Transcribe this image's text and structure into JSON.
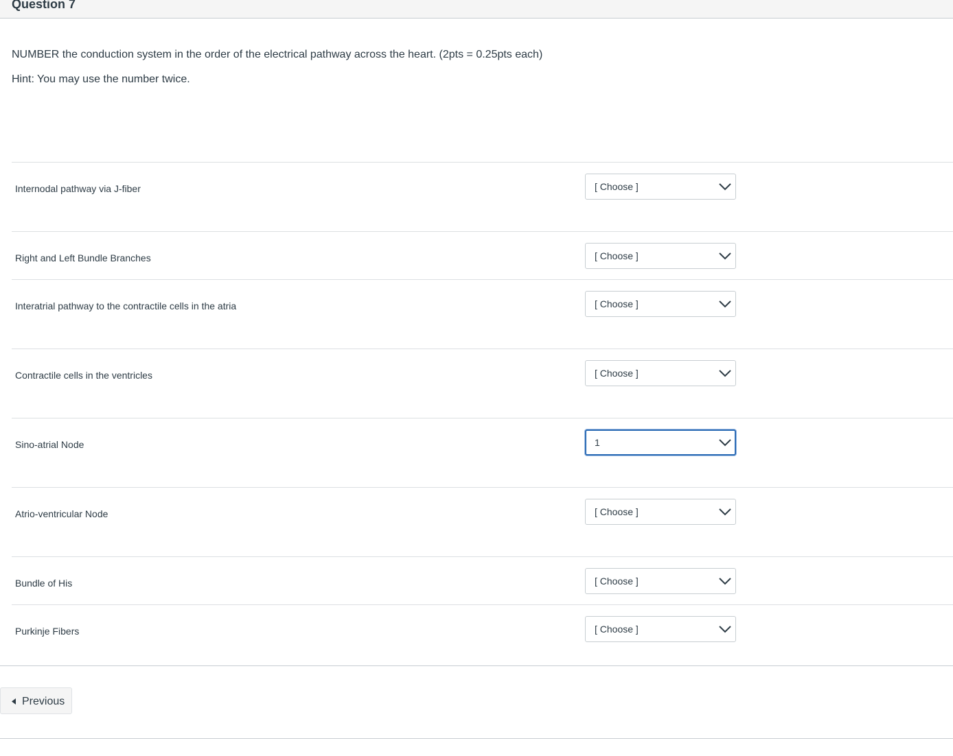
{
  "question": {
    "title": "Question 7",
    "instruction": "NUMBER the conduction system in the order of the electrical pathway across the heart. (2pts = 0.25pts each)",
    "hint": "Hint: You may use the number twice."
  },
  "rows": [
    {
      "label": "Internodal pathway via J-fiber",
      "selected": "[ Choose ]"
    },
    {
      "label": "Right and Left Bundle Branches",
      "selected": "[ Choose ]"
    },
    {
      "label": "Interatrial pathway to the contractile cells in the atria",
      "selected": "[ Choose ]"
    },
    {
      "label": "Contractile cells in the ventricles",
      "selected": "[ Choose ]"
    },
    {
      "label": "Sino-atrial Node",
      "selected": "1"
    },
    {
      "label": "Atrio-ventricular Node",
      "selected": "[ Choose ]"
    },
    {
      "label": "Bundle of His",
      "selected": "[ Choose ]"
    },
    {
      "label": "Purkinje Fibers",
      "selected": "[ Choose ]"
    }
  ],
  "navigation": {
    "previous_label": "Previous"
  },
  "icons": {
    "select_arrow": "chevron-down-icon",
    "previous": "caret-left-icon"
  },
  "colors": {
    "focus_border": "#2b6bb5",
    "text": "#2d3b45",
    "divider": "#dcdfe2"
  }
}
